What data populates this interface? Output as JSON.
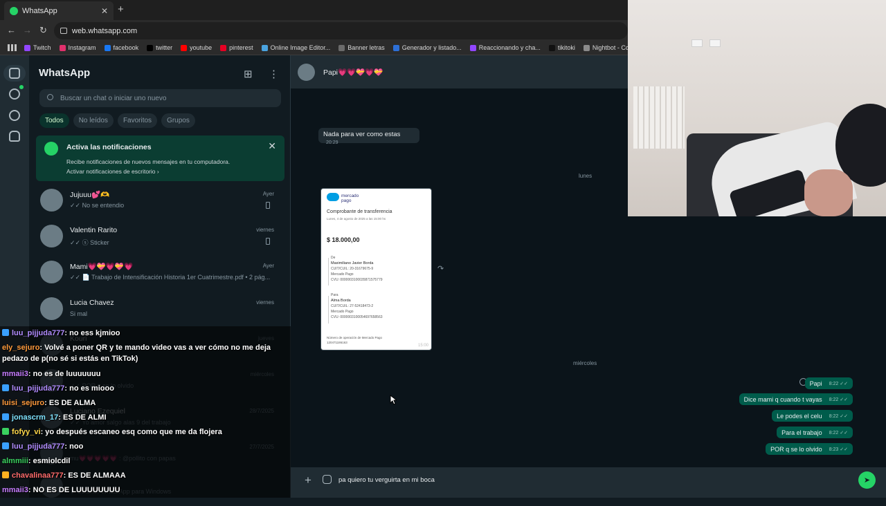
{
  "browser": {
    "tab_title": "WhatsApp",
    "tab_close": "✕",
    "new_tab": "+",
    "url": "web.whatsapp.com",
    "bookmarks": [
      {
        "label": "Twitch",
        "color": "#9146ff"
      },
      {
        "label": "Instagram",
        "color": "#e1306c"
      },
      {
        "label": "facebook",
        "color": "#1877f2"
      },
      {
        "label": "twitter",
        "color": "#000000"
      },
      {
        "label": "youtube",
        "color": "#ff0000"
      },
      {
        "label": "pinterest",
        "color": "#e60023"
      },
      {
        "label": "Online Image Editor...",
        "color": "#4aa3df"
      },
      {
        "label": "Banner letras",
        "color": "#6b6b6b"
      },
      {
        "label": "Generador y listado...",
        "color": "#2d6fd6"
      },
      {
        "label": "Reaccionando y cha...",
        "color": "#9146ff"
      },
      {
        "label": "tikitoki",
        "color": "#111111"
      },
      {
        "label": "Nightbot - Comma...",
        "color": "#8a8a8a"
      }
    ]
  },
  "whatsapp": {
    "title": "WhatsApp",
    "search_placeholder": "Buscar un chat o iniciar uno nuevo",
    "filters": [
      "Todos",
      "No leídos",
      "Favoritos",
      "Grupos"
    ],
    "notification": {
      "title": "Activa las notificaciones",
      "body": "Recibe notificaciones de nuevos mensajes en tu computadora.",
      "link": "Activar notificaciones de escritorio ›",
      "close": "✕"
    },
    "chats": [
      {
        "name": "Jujuuu💕🫶",
        "preview": "✓✓ No se entendio",
        "time": "Ayer",
        "pinned": true
      },
      {
        "name": "Valentin Rarito",
        "preview": "✓✓ ⓢ Sticker",
        "time": "viernes",
        "pinned": true
      },
      {
        "name": "Mami💗💝💗💝💗",
        "preview": "✓✓ 📄 Trabajo de Intensificación Historia 1er Cuatrimestre.pdf • 2 pág...",
        "time": "Ayer",
        "pinned": false
      },
      {
        "name": "Lucia Chavez",
        "preview": "Si mal",
        "time": "viernes",
        "pinned": false
      },
      {
        "name": "Kouri",
        "preview": "",
        "time": "jueves",
        "pinned": false
      },
      {
        "name": "",
        "preview": "✓✓ POR q se lo olvido",
        "time": "miércoles",
        "pinned": false
      },
      {
        "name": "Luciano Ezequiel",
        "preview": "✓✓ Yo amor salgo alas 9 del trabajo",
        "time": "28/7/2025",
        "pinned": false
      },
      {
        "name": "",
        "preview": "mu💗💗💗💗💗 : @pollito con papas",
        "time": "27/7/2025",
        "pinned": false
      },
      {
        "name": "",
        "preview": "⬇ Obtener WhatsApp para Windows",
        "time": "",
        "pinned": false
      }
    ],
    "conversation": {
      "contact": "Papi💗💗💝💗💝",
      "incoming": {
        "text": "Nada para ver como estas",
        "time": "20:29"
      },
      "day_labels": [
        "lunes",
        "miércoles"
      ],
      "receipt": {
        "brand": "mercado pago",
        "title": "Comprobante de transferencia",
        "date": "Lunes, 4 de agosto de 2025 a las 15:00 hs",
        "amount": "$ 18.000,00",
        "from_label": "De",
        "from_name": "Maximiliano Javier Borda",
        "from_cuit": "CUIT/CUIL: 20-31679675-9",
        "from_bank": "Mercado Pago",
        "from_cvu": "CVU: 0000003100035871575779",
        "to_label": "Para",
        "to_name": "Alma Borda",
        "to_cuit": "CUIT/CUIL: 27-52418473-2",
        "to_bank": "Mercado Pago",
        "to_cvu": "CVU: 0000003100054697658563",
        "op_label": "Número de operación de Mercado Pago",
        "op_number": "120471186163",
        "time": "15:00"
      },
      "outgoing": [
        {
          "text": "Papi",
          "time": "8:22 ✓✓"
        },
        {
          "text": "Dice mami q cuando t vayas",
          "time": "8:22 ✓✓"
        },
        {
          "text": "Le podes el celu",
          "time": "8:22 ✓✓"
        },
        {
          "text": "Para el trabajo",
          "time": "8:22 ✓✓"
        },
        {
          "text": "POR q se lo olvido",
          "time": "8:23 ✓✓"
        }
      ],
      "composer_text": "pa quiero tu verguirta en mi boca",
      "send_icon": "➤"
    }
  },
  "stream_chat": [
    {
      "user": "luu_pijjuda777",
      "msg": ": no ess kjmioo",
      "color": "#b18cff",
      "badge": "#3aa0ff"
    },
    {
      "user": "ely_sejuro",
      "msg": ": Volvé a poner QR y te mando video vas a ver cómo no me deja",
      "color": "#ff9a3c",
      "badge": ""
    },
    {
      "user": "",
      "msg": "pedazo de p(no sé si estás en TikTok)",
      "color": "#ffffff",
      "badge": ""
    },
    {
      "user": "mmaii3",
      "msg": ": no es de luuuuuuu",
      "color": "#c77dff",
      "badge": ""
    },
    {
      "user": "luu_pijjuda777",
      "msg": ": no es miooo",
      "color": "#b18cff",
      "badge": "#3aa0ff"
    },
    {
      "user": "luisi_sejuro",
      "msg": ": ES DE ALMA",
      "color": "#ff9a3c",
      "badge": ""
    },
    {
      "user": "jonascrm_17",
      "msg": ": ES DE ALMI",
      "color": "#7fe3ff",
      "badge": "#3aa0ff"
    },
    {
      "user": "fofyy_vi",
      "msg": ": yo después escaneo esq como que me da flojera",
      "color": "#ffd84a",
      "badge": "#3ad15f"
    },
    {
      "user": "luu_pijjuda777",
      "msg": ": noo",
      "color": "#b18cff",
      "badge": "#3aa0ff"
    },
    {
      "user": "almmiii",
      "msg": ": esmiolcdil",
      "color": "#3ad15f",
      "badge": ""
    },
    {
      "user": "chavalinaa777",
      "msg": ": ES DE ALMAAA",
      "color": "#ff6b6b",
      "badge": "#ffb020"
    },
    {
      "user": "mmaii3",
      "msg": ": NO ES DE LUUUUUUUU",
      "color": "#c77dff",
      "badge": ""
    }
  ]
}
